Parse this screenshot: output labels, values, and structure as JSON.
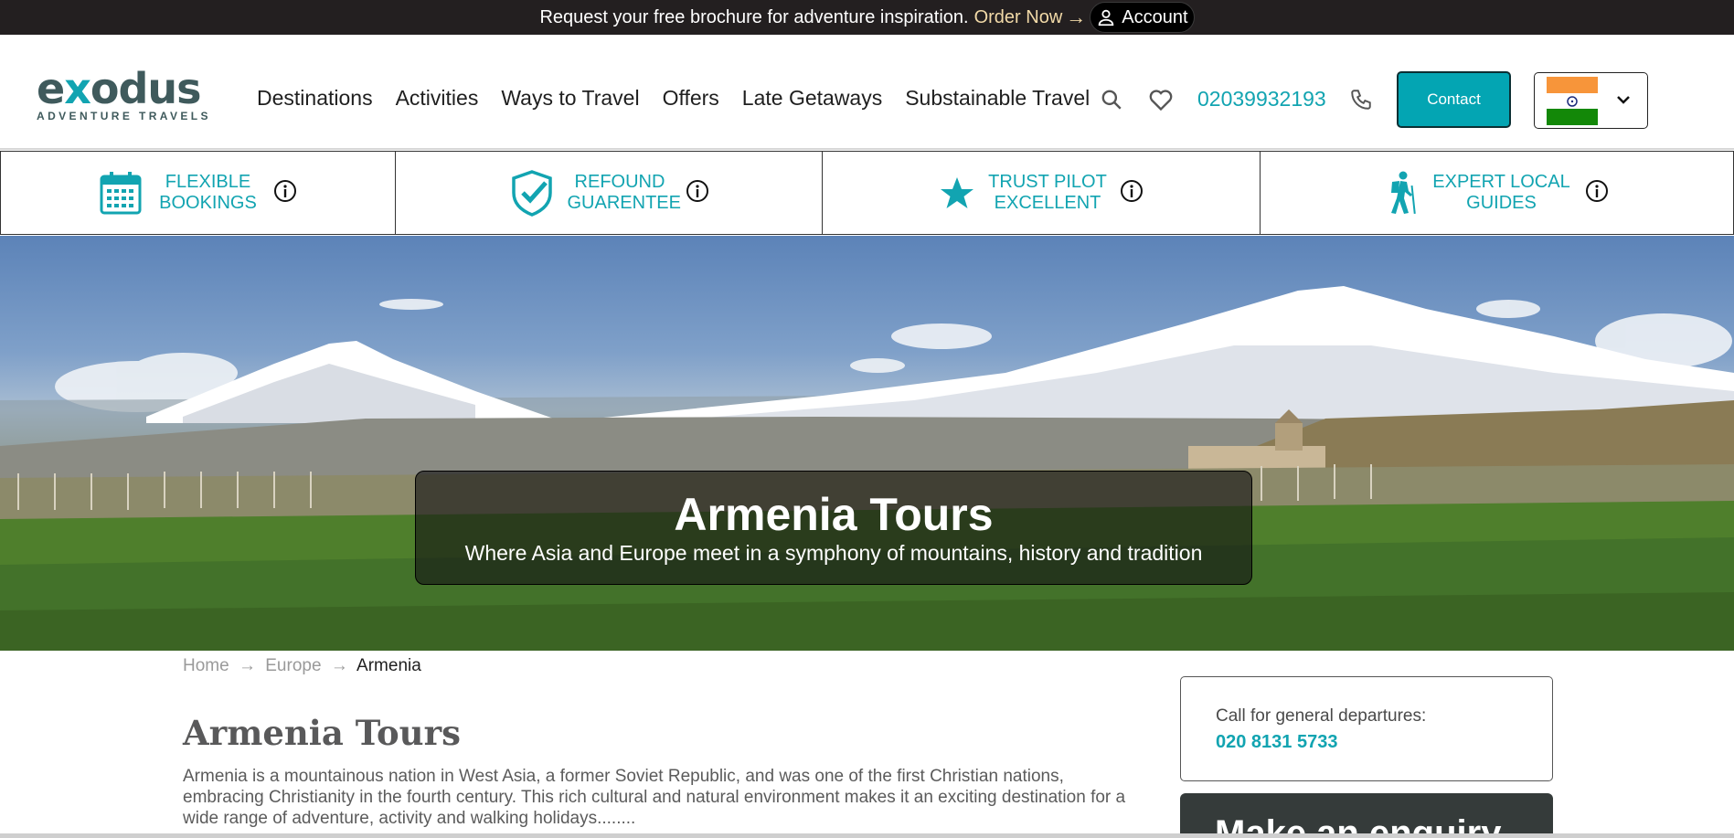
{
  "topbar": {
    "promo_text": "Request your free brochure for adventure inspiration.",
    "order_label": "Order Now",
    "account_label": "Account"
  },
  "header": {
    "logo_word_start": "e",
    "logo_word_x": "x",
    "logo_word_end": "odus",
    "logo_subtitle": "ADVENTURE TRAVELS",
    "nav": [
      "Destinations",
      "Activities",
      "Ways to Travel",
      "Offers",
      "Late Getaways",
      "Substainable Travel"
    ],
    "phone": "02039932193",
    "contact_label": "Contact",
    "country_flag": "india-flag",
    "brand_color": "#12a4b1"
  },
  "features": [
    {
      "line1": "FLEXIBLE",
      "line2": "BOOKINGS",
      "icon": "calendar-icon"
    },
    {
      "line1": "REFOUND",
      "line2": "GUARENTEE",
      "icon": "shield-check-icon"
    },
    {
      "line1": "TRUST PILOT",
      "line2": "EXCELLENT",
      "icon": "star-icon"
    },
    {
      "line1": "EXPERT LOCAL",
      "line2": "GUIDES",
      "icon": "hiker-icon"
    }
  ],
  "hero": {
    "title": "Armenia Tours",
    "subtitle": "Where Asia and Europe meet in a symphony of mountains, history and tradition"
  },
  "breadcrumb": {
    "home": "Home",
    "sep": "→",
    "europe": "Europe",
    "current": "Armenia"
  },
  "main": {
    "title": "Armenia Tours",
    "intro": "Armenia is a mountainous nation in West Asia, a former Soviet Republic, and was one of the first Christian nations, embracing Christianity in the fourth century. This rich cultural and natural environment makes it an exciting destination for a wide range of adventure, activity and walking holidays........"
  },
  "sidebar": {
    "call_label": "Call for general departures:",
    "call_number": "020 8131 5733",
    "enquiry_title": "Make an enquiry"
  }
}
